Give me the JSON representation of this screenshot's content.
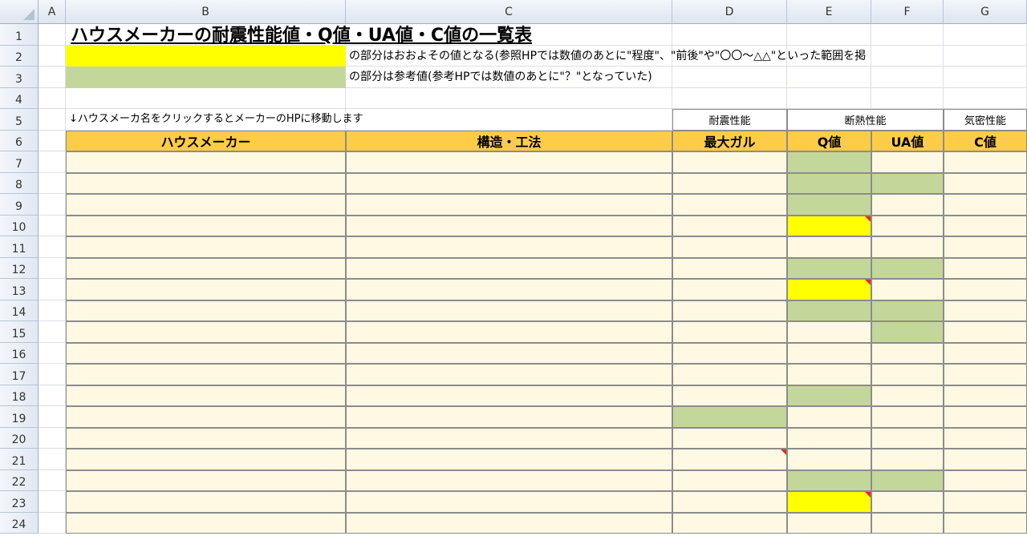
{
  "columns": [
    "A",
    "B",
    "C",
    "D",
    "E",
    "F",
    "G"
  ],
  "rows": [
    "1",
    "2",
    "3",
    "4",
    "5",
    "6",
    "7",
    "8",
    "9",
    "10",
    "11",
    "12",
    "13",
    "14",
    "15",
    "16",
    "17",
    "18",
    "19",
    "20",
    "21",
    "22",
    "23",
    "24"
  ],
  "title": "ハウスメーカーの耐震性能値・Q値・UA値・C値の一覧表",
  "legend": {
    "approx_note": "の部分はおおよその値となる(参照HPでは数値のあとに\"程度\"、\"前後\"や\"〇〇～△△\"といった範囲を掲",
    "reference_note": "の部分は参考値(参考HPでは数値のあとに\"？\"となっていた)",
    "approx_color": "#ffff00",
    "reference_color": "#c4d79b"
  },
  "instruction": "↓ハウスメーカ名をクリックするとメーカーのHPに移動します",
  "groups": {
    "seismic": "耐震性能",
    "insulation": "断熱性能",
    "airtight": "気密性能"
  },
  "headers": {
    "maker": "ハウスメーカー",
    "structure": "構造・工法",
    "max_gal": "最大ガル",
    "q": "Q値",
    "ua": "UA値",
    "c": "C値"
  },
  "colors": {
    "header_fill": "#ffcc4a",
    "cell_fill": "#fff9e3",
    "comment_marker": "#e52b1c"
  },
  "cell_states": {
    "7": {
      "E": "green"
    },
    "8": {
      "E": "green",
      "F": "green"
    },
    "9": {
      "E": "green"
    },
    "10": {
      "E": "yellow"
    },
    "12": {
      "E": "green",
      "F": "green"
    },
    "13": {
      "E": "yellow"
    },
    "14": {
      "E": "green",
      "F": "green"
    },
    "15": {
      "F": "green"
    },
    "18": {
      "E": "green"
    },
    "19": {
      "D": "green"
    },
    "22": {
      "E": "green",
      "F": "green"
    },
    "23": {
      "E": "yellow"
    }
  },
  "comment_markers": [
    "E10",
    "E13",
    "D21",
    "E23"
  ]
}
